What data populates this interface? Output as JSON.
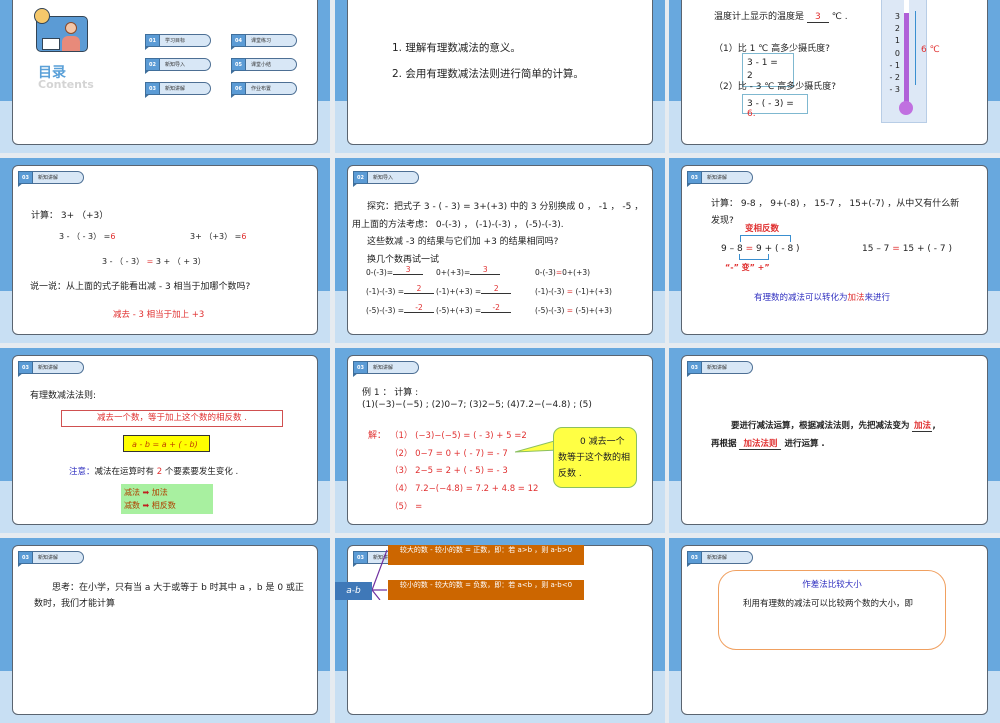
{
  "colors": {
    "slide_blue": "#68a8de",
    "slide_light": "#c8dff3",
    "accent_red": "#e03030",
    "accent_blue": "#3030c0"
  },
  "toc": {
    "title": "目录",
    "subtitle": "Contents",
    "items": [
      {
        "num": "01",
        "label": "学习目标"
      },
      {
        "num": "02",
        "label": "新知导入"
      },
      {
        "num": "03",
        "label": "新知讲解"
      },
      {
        "num": "04",
        "label": "课堂练习"
      },
      {
        "num": "05",
        "label": "课堂小结"
      },
      {
        "num": "06",
        "label": "作业布置"
      }
    ]
  },
  "goals": {
    "items": [
      "1. 理解有理数减法的意义。",
      "2. 会用有理数减法法则进行简单的计算。"
    ]
  },
  "thermo": {
    "q0": "温度计上显示的温度是",
    "a0": "3",
    "unit": "℃ .",
    "q1": "（1）比 1 ℃ 高多少摄氏度?",
    "a1": "3 - 1 =",
    "a1b": "2",
    "q2": "（2）比 - 3 ℃ 高多少摄氏度?",
    "a2": "3 - ( - 3) =",
    "a2b": "6.",
    "scale": [
      "3",
      "2",
      "1",
      "0",
      "- 1",
      "- 2",
      "- 3"
    ],
    "diff": "6 ℃"
  },
  "tag_intro": {
    "num": "02",
    "label": "新知导入"
  },
  "tag_explain": {
    "num": "03",
    "label": "新知讲解"
  },
  "calc": {
    "title": "计算： 3+ （+3）",
    "e1": "3 - （ - 3） =",
    "e1a": "6",
    "e2": "3+ （+3） =",
    "e2a": "6",
    "e3a": "3 - （ - 3）",
    "e3eq": "=",
    "e3b": "3 + （ + 3）",
    "say": "说一说：从上面的式子能看出减 - 3 相当于加哪个数吗?",
    "answer": "减去 - 3 相当于加上 +3"
  },
  "explore": {
    "p1": "探究：把式子 3 - ( - 3) = 3+(+3) 中的 3 分别换成 0 ， -1 ， -5 ，用上面的方法考虑： 0-(-3) ， (-1)-(-3) ， (-5)-(-3).",
    "p2": "这些数减 -3 的结果与它们加 +3 的结果相同吗?",
    "p3": "换几个数再试一试",
    "rows": [
      {
        "a": "0-(-3)=",
        "av": "3",
        "b": "0+(+3)=",
        "bv": "3",
        "c1": "0-(-3)",
        "c2": "0+(+3)"
      },
      {
        "a": "(-1)-(-3) =",
        "av": "2",
        "b": "(-1)+(+3) =",
        "bv": "2",
        "c1": "(-1)-(-3) ",
        "c2": " (-1)+(+3)"
      },
      {
        "a": "(-5)-(-3) =",
        "av": "-2",
        "b": "(-5)+(+3) =",
        "bv": "-2",
        "c1": "(-5)-(-3) ",
        "c2": " (-5)+(+3)"
      }
    ],
    "eq": "="
  },
  "find": {
    "q": "计算： 9-8 ， 9+(-8) ， 15-7 ， 15+(-7) ，从中又有什么新发现?",
    "top": "变相反数",
    "e1a": "9 – 8",
    "e1b": "9 + ( - 8 )",
    "e2a": "15 – 7",
    "e2b": "15 + ( - 7 )",
    "eq": "=",
    "bottom": "“-” 变” +”",
    "c1": "有理数的减法可以转化为",
    "c2": "加法",
    "c3": "来进行"
  },
  "rule": {
    "title": "有理数减法法则:",
    "rule": "减去一个数，等于加上这个数的相反数 .",
    "formula": "a - b = a + ( - b)",
    "n1": "注意：",
    "n2": "减法在运算时有",
    "n3": "2",
    "n4": "个要素要发生变化 .",
    "r1a": "减法",
    "r1b": "加法",
    "r2a": "减数",
    "r2b": "相反数"
  },
  "example": {
    "title": "例 1 ： 计算 :",
    "q": "(1)(−3)−(−5) ; (2)0−7; (3)2−5; (4)7.2−(−4.8) ; (5)",
    "sol": "解：",
    "lines": [
      "（1） (−3)−(−5)  = ( - 3) + 5 =2",
      "（2） 0−7  =  0 + ( - 7)  =  - 7",
      "（3） 2−5  =  2 + ( - 5)  = - 3",
      "（4） 7.2−(−4.8)  = 7.2 + 4.8  = 12",
      "（5）   ="
    ],
    "callout": "0 减去一个数等于这个数的相反数 ."
  },
  "summary": {
    "l1": "要进行减法运算，根据减法法则，先把减法变为",
    "b1": "加法",
    "p": ",",
    "l2": "再根据",
    "b2": "加法法则",
    "l3": "进行运算 ."
  },
  "think": {
    "text": "思考：在小学，只有当 a 大于或等于 b 时其中 a ，b 是 0 或正数时，我们才能计算"
  },
  "compare": {
    "box1": "较大的数 - 较小的数 = 正数，即：若 a>b ，则 a-b>0",
    "box2": "较小的数 - 较大的数 = 负数，即：若 a<b ，则 a-b<0",
    "ab": "a-b"
  },
  "diffm": {
    "title": "作差法比较大小",
    "text": "利用有理数的减法可以比较两个数的大小，即"
  }
}
